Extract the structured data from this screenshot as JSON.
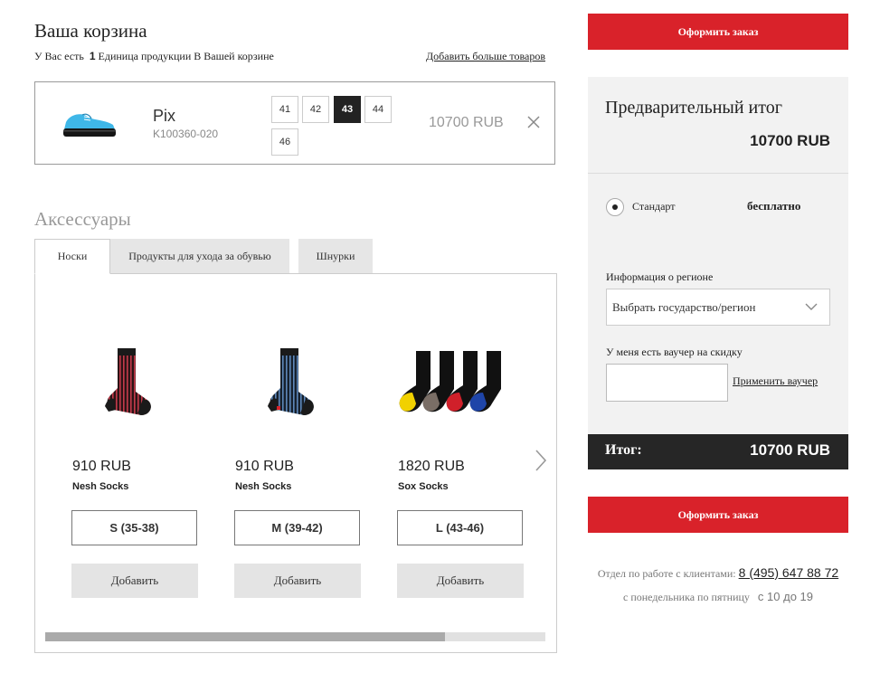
{
  "cart": {
    "title": "Ваша корзина",
    "summary_prefix": "У Вас есть",
    "summary_count": "1",
    "summary_suffix": "Единица продукции В Вашей корзине",
    "add_more_link": "Добавить больше товаров"
  },
  "product": {
    "name": "Pix",
    "sku": "K100360-020",
    "sizes": [
      "41",
      "42",
      "43",
      "44",
      "46"
    ],
    "selected_size": "43",
    "price": "10700 RUB",
    "image_icon": "shoe-image",
    "remove_icon": "close-icon"
  },
  "accessories": {
    "title": "Аксессуары",
    "tabs": [
      {
        "label": "Носки",
        "active": true
      },
      {
        "label": "Продукты для ухода за обувью",
        "active": false
      },
      {
        "label": "Шнурки",
        "active": false
      }
    ],
    "items": [
      {
        "price": "910 RUB",
        "name": "Nesh Socks",
        "size": "S (35-38)",
        "add_label": "Добавить",
        "image": "red-striped-sock"
      },
      {
        "price": "910 RUB",
        "name": "Nesh Socks",
        "size": "M (39-42)",
        "add_label": "Добавить",
        "image": "blue-striped-sock"
      },
      {
        "price": "1820 RUB",
        "name": "Sox Socks",
        "size": "L (43-46)",
        "add_label": "Добавить",
        "image": "four-sock-pack"
      }
    ],
    "next_icon": "chevron-right-icon",
    "scroll_progress": 0.8
  },
  "summary": {
    "checkout_label": "Оформить заказ",
    "subtotal_title": "Предварительный итог",
    "subtotal_value": "10700 RUB",
    "shipping_option": "Стандарт",
    "shipping_price": "бесплатно",
    "region_label": "Информация о регионе",
    "region_select_value": "Выбрать государство/регион",
    "voucher_label": "У меня есть ваучер на скидку",
    "voucher_apply": "Применить ваучер",
    "total_label": "Итог:",
    "total_value": "10700 RUB"
  },
  "contact": {
    "dept_label": "Отдел по работе с клиентами:",
    "phone": "8 (495) 647 88 72",
    "days": "с понедельника по пятницу",
    "hours": "с 10 до 19"
  },
  "colors": {
    "accent_red": "#d9222a",
    "total_bar": "#262626",
    "summary_bg": "#f2f2f2"
  }
}
